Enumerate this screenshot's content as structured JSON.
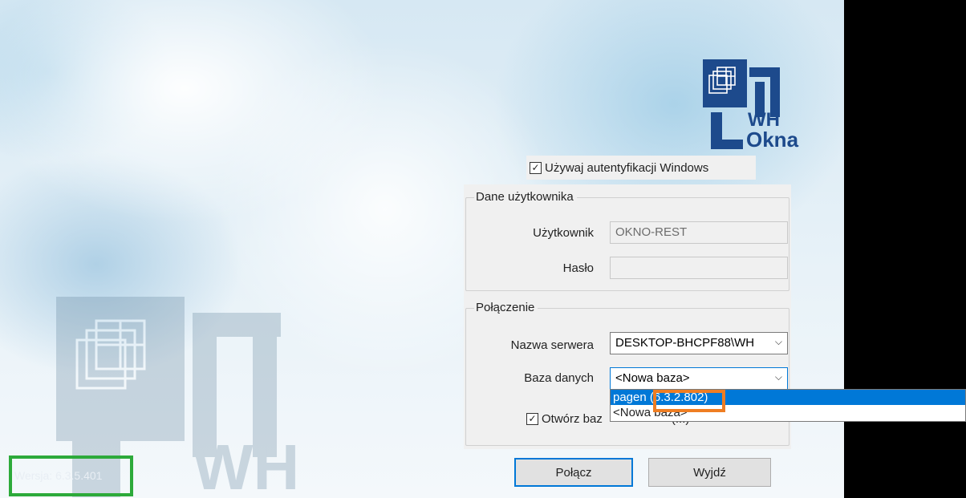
{
  "logo": {
    "line1": "WH",
    "line2": "Okna"
  },
  "auth": {
    "label": "Używaj autentyfikacji Windows",
    "checked": true
  },
  "user_group": {
    "title": "Dane użytkownika",
    "user_label": "Użytkownik",
    "user_value": "OKNO-REST",
    "password_label": "Hasło",
    "password_value": ""
  },
  "connection_group": {
    "title": "Połączenie",
    "server_label": "Nazwa serwera",
    "server_value": "DESKTOP-BHCPF88\\WH",
    "database_label": "Baza danych",
    "database_value": "<Nowa baza>",
    "database_options": [
      "pagen (6.3.2.802)",
      "<Nowa baza>"
    ],
    "selected_option_index": 0
  },
  "open_db": {
    "label": "Otwórz baz",
    "checked": true,
    "overlapped_text": "(...)"
  },
  "buttons": {
    "connect": "Połącz",
    "exit": "Wyjdź"
  },
  "version": {
    "label": "Wersja: 6.3.5.401"
  },
  "colors": {
    "brand": "#1d4a8c",
    "selection": "#0078d7",
    "highlight_orange": "#ef7d22",
    "highlight_green": "#2daa3a"
  }
}
